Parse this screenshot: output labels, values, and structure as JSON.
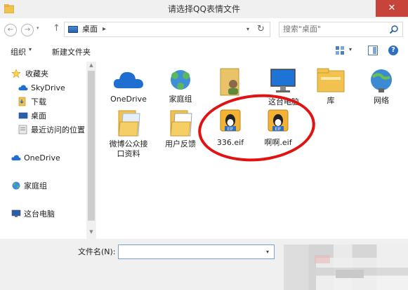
{
  "window": {
    "title": "请选择QQ表情文件",
    "close_glyph": "✕"
  },
  "nav": {
    "back_glyph": "←",
    "forward_glyph": "→",
    "history_glyph": "▾",
    "up_glyph": "↑",
    "address": "桌面",
    "address_arrow": "▸",
    "address_dropdown": "▾",
    "refresh_glyph": "↻",
    "search_placeholder": "搜索\"桌面\""
  },
  "toolbar": {
    "organize_label": "组织",
    "organize_arrow": "▾",
    "new_folder_label": "新建文件夹",
    "view_arrow": "▾",
    "help_glyph": "?"
  },
  "sidebar": {
    "items": [
      {
        "label": "收藏夹",
        "icon": "star-icon"
      },
      {
        "label": "SkyDrive",
        "icon": "cloud-icon"
      },
      {
        "label": "下载",
        "icon": "download-folder-icon"
      },
      {
        "label": "桌面",
        "icon": "desktop-icon"
      },
      {
        "label": "最近访问的位置",
        "icon": "recent-places-icon"
      },
      {
        "label": "OneDrive",
        "icon": "cloud-icon"
      },
      {
        "label": "家庭组",
        "icon": "homegroup-icon"
      },
      {
        "label": "这台电脑",
        "icon": "computer-icon"
      }
    ],
    "scroll_up": "▲",
    "scroll_down": "▼"
  },
  "files": [
    {
      "label": "OneDrive",
      "icon": "onedrive-icon"
    },
    {
      "label": "家庭组",
      "icon": "homegroup-icon"
    },
    {
      "label": "",
      "icon": "user-folder-icon"
    },
    {
      "label": "这台电脑",
      "icon": "computer-icon"
    },
    {
      "label": "库",
      "icon": "library-icon"
    },
    {
      "label": "网络",
      "icon": "network-icon"
    },
    {
      "label": "微博公众接口资料",
      "icon": "folder-icon"
    },
    {
      "label": "用户反馈",
      "icon": "folder-icon"
    },
    {
      "label": "336.eif",
      "icon": "qq-eif-icon"
    },
    {
      "label": "啊啊.eif",
      "icon": "qq-eif-icon"
    }
  ],
  "eif_badge": "EIF",
  "bottom": {
    "filename_label": "文件名(N):",
    "filename_value": "",
    "filename_dropdown": "▾"
  },
  "colors": {
    "accent": "#2e6fc2",
    "close_red": "#c7443a",
    "highlight_red": "#e31212",
    "folder_yellow": "#f2c24f",
    "cloud_blue": "#1e6fd1"
  }
}
